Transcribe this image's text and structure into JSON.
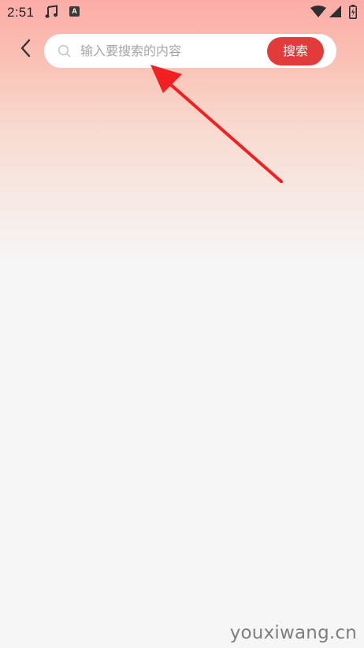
{
  "status_bar": {
    "time": "2:51",
    "icons": [
      "music-note-icon",
      "a-badge-icon",
      "wifi-icon",
      "signal-icon",
      "battery-icon"
    ],
    "badge_letter": "A"
  },
  "header": {
    "back_icon": "chevron-left-icon",
    "search": {
      "icon": "search-icon",
      "placeholder": "输入要搜索的内容",
      "value": "",
      "button_label": "搜索"
    }
  },
  "watermark": "youxiwang.cn",
  "colors": {
    "accent": "#e23b3b",
    "arrow": "#f22020",
    "background": "#f6f6f6",
    "gradient_top": "#fd9f9a"
  }
}
